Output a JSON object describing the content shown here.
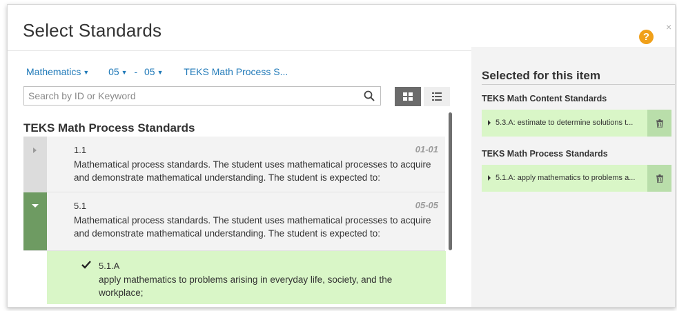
{
  "dialog": {
    "title": "Select Standards",
    "help_glyph": "?",
    "close_glyph": "×"
  },
  "filters": {
    "subject": "Mathematics",
    "grade_from": "05",
    "range_sep": "-",
    "grade_to": "05",
    "standard_set": "TEKS Math Process S..."
  },
  "search": {
    "placeholder": "Search by ID or Keyword",
    "value": ""
  },
  "list": {
    "section_title": "TEKS Math Process Standards",
    "standards": [
      {
        "id": "1.1",
        "grade": "01-01",
        "description": "Mathematical process standards. The student uses mathematical processes to acquire and demonstrate mathematical understanding. The student is expected to:",
        "expanded": false
      },
      {
        "id": "5.1",
        "grade": "05-05",
        "description": "Mathematical process standards. The student uses mathematical processes to acquire and demonstrate mathematical understanding. The student is expected to:",
        "expanded": true
      }
    ],
    "sub_items": [
      {
        "id": "5.1.A",
        "description": "apply mathematics to problems arising in everyday life, society, and the workplace;",
        "selected": true
      }
    ]
  },
  "selected_panel": {
    "title": "Selected for this item",
    "groups": [
      {
        "title": "TEKS Math Content Standards",
        "items": [
          {
            "text": "5.3.A: estimate to determine solutions t..."
          }
        ]
      },
      {
        "title": "TEKS Math Process Standards",
        "items": [
          {
            "text": "5.1.A: apply mathematics to problems a..."
          }
        ]
      }
    ]
  },
  "icons": {
    "search": "search-icon",
    "grid_view": "grid-view-icon",
    "list_view": "list-view-icon",
    "check": "check-icon",
    "trash": "trash-icon"
  },
  "colors": {
    "link": "#1f79b8",
    "help": "#f0a01a",
    "expanded_toggle": "#6e9b62",
    "selected_bg": "#d9f6c7",
    "delete_bg": "#b9deaa"
  }
}
